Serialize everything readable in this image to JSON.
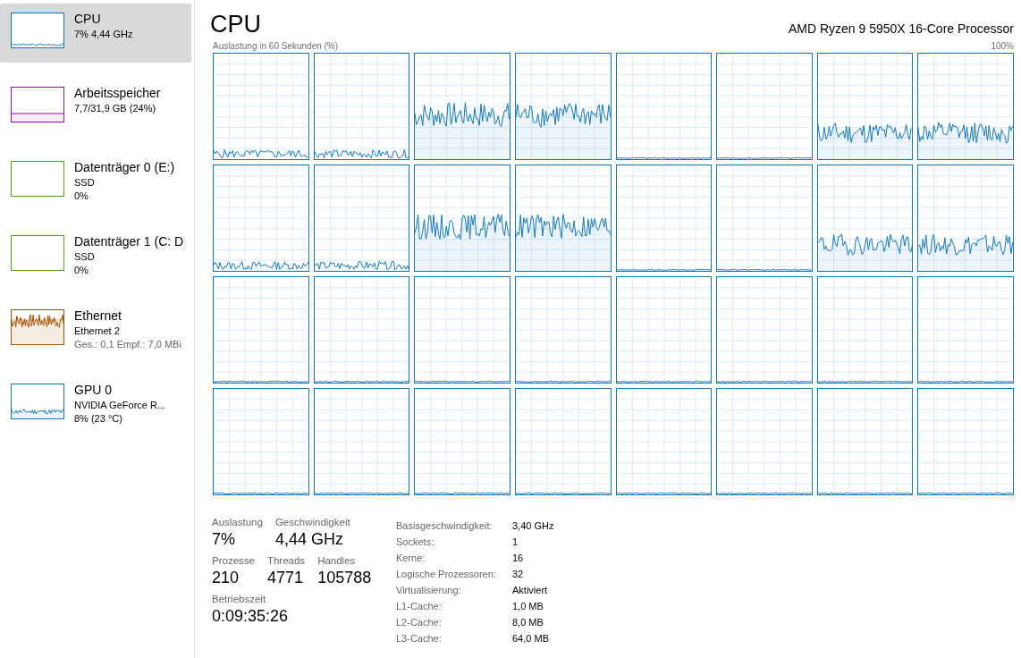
{
  "sidebar": {
    "items": [
      {
        "kind": "cpu",
        "color": "#1177bb",
        "title": "CPU",
        "lines": [
          "7% 4,44 GHz"
        ],
        "selected": true
      },
      {
        "kind": "memory",
        "color": "#8b12ae",
        "title": "Arbeitsspeicher",
        "lines": [
          "7,7/31,9 GB (24%)"
        ],
        "selected": false
      },
      {
        "kind": "disk",
        "color": "#4da60c",
        "title": "Datenträger 0 (E:)",
        "lines": [
          "SSD",
          "0%"
        ],
        "selected": false
      },
      {
        "kind": "disk",
        "color": "#4da60c",
        "title": "Datenträger 1 (C: D",
        "lines": [
          "SSD",
          "0%"
        ],
        "selected": false
      },
      {
        "kind": "network",
        "color": "#a74f01",
        "title": "Ethernet",
        "lines": [
          "Ethernet 2"
        ],
        "muted_line": "Ges.: 0,1  Empf.: 7,0 MBi",
        "selected": false
      },
      {
        "kind": "gpu",
        "color": "#1177bb",
        "title": "GPU 0",
        "lines": [
          "NVIDIA GeForce R...",
          "8%  (23 °C)"
        ],
        "selected": false
      }
    ]
  },
  "main": {
    "title": "CPU",
    "processor": "AMD Ryzen 9 5950X 16-Core Processor",
    "graph_caption": "Auslastung in 60 Sekunden (%)",
    "graph_max": "100%",
    "cores": [
      {
        "kind": "light"
      },
      {
        "kind": "light"
      },
      {
        "kind": "busy"
      },
      {
        "kind": "busy"
      },
      {
        "kind": "flat"
      },
      {
        "kind": "flat"
      },
      {
        "kind": "medium"
      },
      {
        "kind": "medium"
      },
      {
        "kind": "light"
      },
      {
        "kind": "light"
      },
      {
        "kind": "busy"
      },
      {
        "kind": "busy"
      },
      {
        "kind": "flat"
      },
      {
        "kind": "flat"
      },
      {
        "kind": "medium"
      },
      {
        "kind": "medium"
      },
      {
        "kind": "flat"
      },
      {
        "kind": "flat"
      },
      {
        "kind": "flat"
      },
      {
        "kind": "flat"
      },
      {
        "kind": "flat"
      },
      {
        "kind": "flat"
      },
      {
        "kind": "flat"
      },
      {
        "kind": "flat"
      },
      {
        "kind": "flat"
      },
      {
        "kind": "flat"
      },
      {
        "kind": "flat"
      },
      {
        "kind": "flat"
      },
      {
        "kind": "flat"
      },
      {
        "kind": "flat"
      },
      {
        "kind": "flat"
      },
      {
        "kind": "flat"
      }
    ],
    "stats": [
      [
        {
          "label": "Auslastung",
          "value": "7%"
        },
        {
          "label": "Geschwindigkeit",
          "value": "4,44 GHz"
        }
      ],
      [
        {
          "label": "Prozesse",
          "value": "210"
        },
        {
          "label": "Threads",
          "value": "4771"
        },
        {
          "label": "Handles",
          "value": "105788"
        }
      ],
      [
        {
          "label": "Betriebszeit",
          "value": "0:09:35:26"
        }
      ]
    ],
    "details": [
      {
        "label": "Basisgeschwindigkeit:",
        "value": "3,40 GHz"
      },
      {
        "label": "Sockets:",
        "value": "1"
      },
      {
        "label": "Kerne:",
        "value": "16"
      },
      {
        "label": "Logische Prozessoren:",
        "value": "32"
      },
      {
        "label": "Virtualisierung:",
        "value": "Aktiviert"
      },
      {
        "label": "L1-Cache:",
        "value": "1,0 MB"
      },
      {
        "label": "L2-Cache:",
        "value": "8,0 MB"
      },
      {
        "label": "L3-Cache:",
        "value": "64,0 MB"
      }
    ]
  }
}
